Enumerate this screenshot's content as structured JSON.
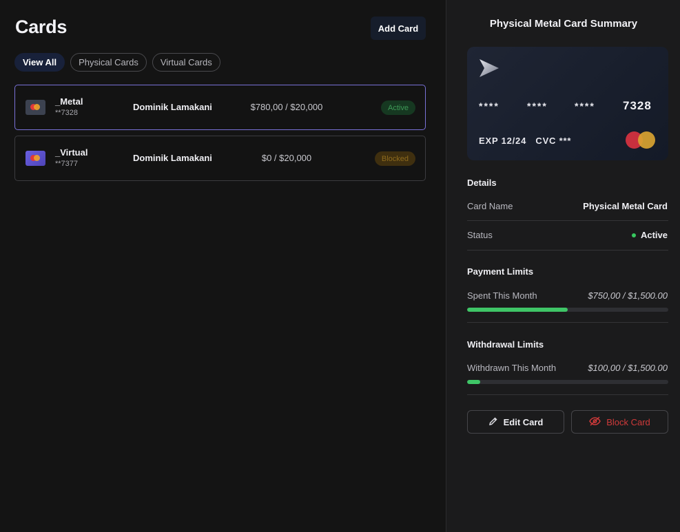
{
  "header": {
    "title": "Cards",
    "add_card_label": "Add Card"
  },
  "tabs": [
    {
      "label": "View All",
      "active": true
    },
    {
      "label": "Physical Cards",
      "active": false
    },
    {
      "label": "Virtual Cards",
      "active": false
    }
  ],
  "cards": [
    {
      "name": "_Metal",
      "number": "**7328",
      "holder": "Dominik Lamakani",
      "amount": "$780,00 / $20,000",
      "status": "Active",
      "selected": true
    },
    {
      "name": "_Virtual",
      "number": "**7377",
      "holder": "Dominik Lamakani",
      "amount": "$0 / $20,000",
      "status": "Blocked",
      "selected": false
    }
  ],
  "summary": {
    "title": "Physical Metal Card Summary",
    "card": {
      "dots": [
        "****",
        "****",
        "****"
      ],
      "last4": "7328",
      "exp": "EXP 12/24",
      "cvc": "CVC ***"
    },
    "details": {
      "heading": "Details",
      "card_name_label": "Card Name",
      "card_name_value": "Physical Metal Card",
      "status_label": "Status",
      "status_value": "Active"
    },
    "payment_limits": {
      "heading": "Payment Limits",
      "label": "Spent This Month",
      "value": "$750,00 / $1,500.00",
      "progress": 0.5
    },
    "withdrawal_limits": {
      "heading": "Withdrawal Limits",
      "label": "Withdrawn This Month",
      "value": "$100,00 / $1,500.00",
      "progress": 0.0667
    },
    "edit_label": "Edit Card",
    "block_label": "Block Card"
  },
  "colors": {
    "accent_green": "#3fc667",
    "danger_red": "#cf3a3a",
    "selected_border": "#7a72d8"
  },
  "icons": {
    "card_logo": "paper-plane-logo",
    "edit": "pencil-icon",
    "block": "eye-off-icon"
  }
}
